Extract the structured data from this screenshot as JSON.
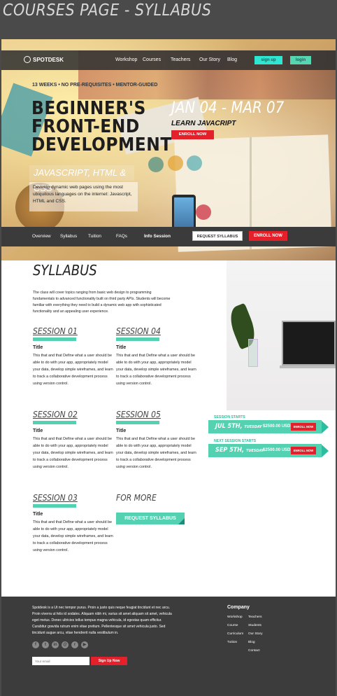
{
  "page_heading": "COURSES PAGE - SYLLABUS",
  "nav": {
    "brand": "SPOTDESK",
    "links": [
      "Workshop",
      "Courses",
      "Teachers",
      "Our Story",
      "Blog"
    ],
    "signup": "sign up",
    "login": "login"
  },
  "hero": {
    "tagline": "13 WEEKS • NO PRE-REQUISITES • MENTOR-GUIDED",
    "title": "BEGINNER'S FRONT-END DEVELOPMENT",
    "subtitle": "JAVASCRIPT, HTML & CSS",
    "description": "Develop dynamic web pages using the most ubiquitous languages on the internet: Javascript, HTML and CSS.",
    "date_range": "JAN 04 - MAR 07",
    "learn": "LEARN JAVACRIPT",
    "enroll": "ENROLL NOW"
  },
  "subnav": {
    "links": [
      "Overview",
      "Syllabus",
      "Tuition",
      "FAQs",
      "Info Session"
    ],
    "request": "REQUEST SYLLABUS",
    "enroll": "ENROLL NOW"
  },
  "syllabus": {
    "title": "SYLLABUS",
    "intro": "The class will cover topics ranging from basic web design to programming fundamentals to advanced functionality built on third party APIs. Students will become familiar with everything they need to build a dynamic web app with sophisticated functionality and an appealing user experience.",
    "sessions": [
      {
        "title": "SESSION 01",
        "sub": "Title",
        "body": "This that and that Define what a user should be able to do with your app, appropriately model your data, develop simple wireframes, and learn to track a collaborative development process using version control."
      },
      {
        "title": "SESSION 04",
        "sub": "Title",
        "body": "This that and that Define what a user should be able to do with your app, appropriately model your data, develop simple wireframes, and learn to track a collaborative development process using version control."
      },
      {
        "title": "SESSION 02",
        "sub": "Title",
        "body": "This that and that Define what a user should be able to do with your app, appropriately model your data, develop simple wireframes, and learn to track a collaborative development process using version control."
      },
      {
        "title": "SESSION 05",
        "sub": "Title",
        "body": "This that and that Define what a user should be able to do with your app, appropriately model your data, develop simple wireframes, and learn to track a collaborative development process using version control."
      },
      {
        "title": "SESSION 03",
        "sub": "Title",
        "body": "This that and that Define what a user should be able to do with your app, appropriately model your data, develop simple wireframes, and learn to track a collaborative development process using version control."
      }
    ],
    "more_title": "FOR MORE",
    "more_button": "REQUEST SYLLABUS"
  },
  "starts": [
    {
      "label": "SESSION STARTS",
      "date": "JUL 5TH,",
      "day": "TUESDAY",
      "price": "$2500.00 USD",
      "enroll": "ENROLL NOW"
    },
    {
      "label": "NEXT SESSION STARTS",
      "date": "SEP 5TH,",
      "day": "TUESDAY",
      "price": "$2500.00 USD",
      "enroll": "ENROLL NOW"
    }
  ],
  "footer": {
    "text": "Spotdesk is a Ut nec tempor purus. Proin a justo quis neque feugiat tincidunt et nec arcu. Proin viverra ut felis id sodales. Aliquam nibh mi, varius sit amet aliquam sit amet, vehicula eget metus. Donec ultricies tellus tempus magna vehicula, id egestas quam efficitur. Curabitur gravida rutrum enim vitae pretium. Pellentesque sit amet vehicula justo. Sed tincidunt augue arcu, vitae hendrerit nulla vestibulum in.",
    "email_placeholder": "Your email",
    "signup": "Sign Up Now",
    "company_title": "Company",
    "col1": [
      "Workshop",
      "Course",
      "Curriculum",
      "Tuition"
    ],
    "col2": [
      "Teachers",
      "Students",
      "Our Story",
      "Blog",
      "Contact"
    ]
  }
}
